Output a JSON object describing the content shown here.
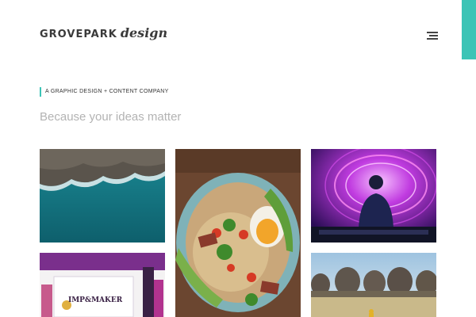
{
  "header": {
    "logo_main": "GROVEPARK",
    "logo_script": "design",
    "menu_icon": "hamburger-menu-icon"
  },
  "intro": {
    "tagline": "A GRAPHIC DESIGN + CONTENT COMPANY",
    "headline": "Because your ideas matter"
  },
  "portfolio": {
    "tiles": [
      {
        "subject": "aerial-coastline-photo"
      },
      {
        "subject": "ramen-bowl-photo"
      },
      {
        "subject": "dj-neon-lights-photo"
      },
      {
        "subject": "branded-packaging-photo",
        "brand_text": "IMP&MAKER"
      },
      {
        "subject": "field-with-trees-photo"
      }
    ]
  },
  "colors": {
    "accent": "#3cc4b6",
    "headline": "#b3b3b3",
    "text": "#333333"
  }
}
